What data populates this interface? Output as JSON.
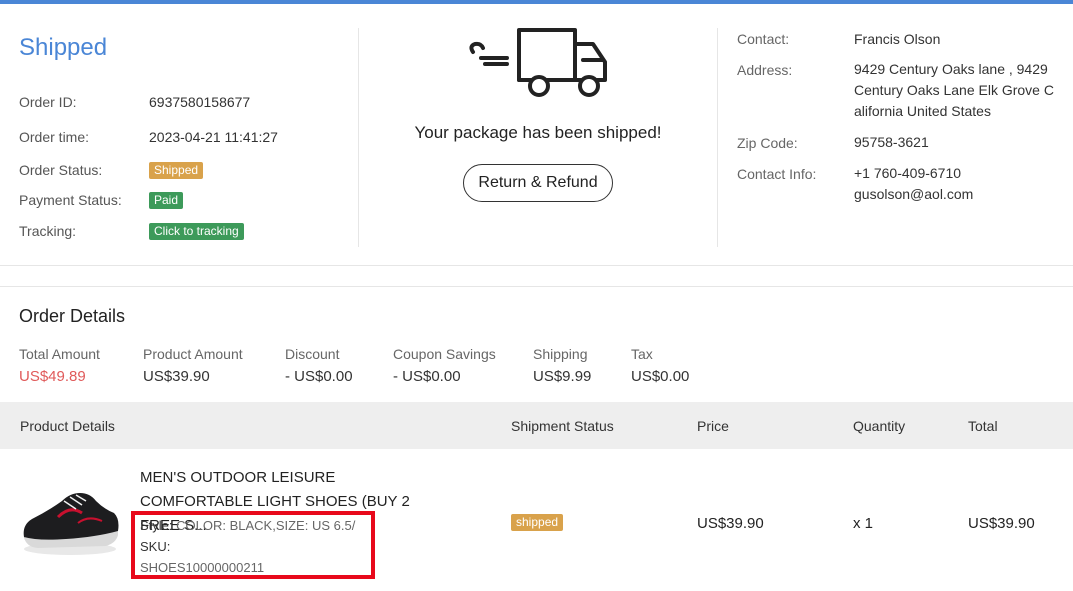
{
  "header": {
    "status_title": "Shipped",
    "fields": [
      {
        "label": "Order ID:",
        "value": "6937580158677"
      },
      {
        "label": "Order time:",
        "value": "2023-04-21 11:41:27"
      }
    ],
    "order_status_label": "Order Status:",
    "order_status_value": "Shipped",
    "payment_status_label": "Payment Status:",
    "payment_status_value": "Paid",
    "tracking_label": "Tracking:",
    "tracking_button": "Click to tracking",
    "shipped_message": "Your package has been shipped!",
    "return_refund_label": "Return & Refund",
    "truck_icon": "delivery-truck-icon"
  },
  "contact": {
    "contact_label": "Contact:",
    "contact_value": "Francis  Olson",
    "address_label": "Address:",
    "address_value": "9429 Century Oaks lane , 9429 Century Oaks Lane  Elk Grove  California  United States",
    "zip_label": "Zip Code:",
    "zip_value": "95758-3621",
    "info_label": "Contact Info:",
    "phone": "+1 760-409-6710",
    "email": "gusolson@aol.com"
  },
  "order_details": {
    "title": "Order Details",
    "amounts": [
      {
        "label": "Total Amount",
        "value": "US$49.89"
      },
      {
        "label": "Product Amount",
        "value": "US$39.90"
      },
      {
        "label": "Discount",
        "value": "- US$0.00"
      },
      {
        "label": "Coupon Savings",
        "value": "- US$0.00"
      },
      {
        "label": "Shipping",
        "value": "US$9.99"
      },
      {
        "label": "Tax",
        "value": "US$0.00"
      }
    ]
  },
  "table": {
    "headers": [
      "Product Details",
      "Shipment Status",
      "Price",
      "Quantity",
      "Total"
    ],
    "rows": [
      {
        "name": "MEN'S OUTDOOR LEISURE COMFORTABLE LIGHT SHOES (BUY 2 FREE S...",
        "style_label": "Style:",
        "style_value": "COLOR: BLACK,SIZE: US 6.5/",
        "sku_label": "SKU:",
        "sku_value": "SHOES10000000211",
        "shipment_status": "shipped",
        "price": "US$39.90",
        "quantity": "x 1",
        "total": "US$39.90"
      }
    ]
  },
  "colors": {
    "accent": "#4a86d6",
    "badge_orange": "#d9a24b",
    "badge_green": "#3d9a5a",
    "total_red": "#e05a5a",
    "highlight_red": "#e8091b"
  }
}
